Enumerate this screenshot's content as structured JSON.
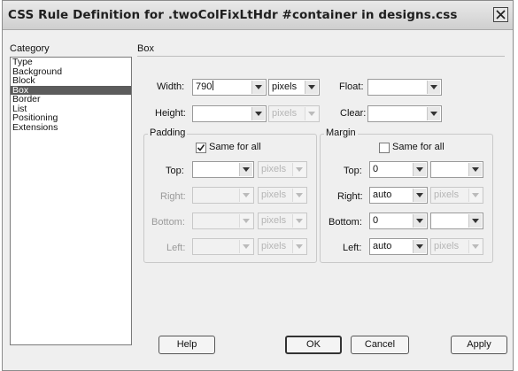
{
  "window": {
    "title": "CSS Rule Definition for .twoColFixLtHdr #container in designs.css"
  },
  "category": {
    "heading": "Category",
    "items": [
      "Type",
      "Background",
      "Block",
      "Box",
      "Border",
      "List",
      "Positioning",
      "Extensions"
    ],
    "selected": "Box"
  },
  "section": {
    "title": "Box"
  },
  "box": {
    "width": {
      "label": "Width:",
      "value": "790",
      "unit": "pixels"
    },
    "height": {
      "label": "Height:",
      "value": "",
      "unit": "pixels"
    },
    "float": {
      "label": "Float:",
      "value": ""
    },
    "clear": {
      "label": "Clear:",
      "value": ""
    }
  },
  "padding": {
    "title": "Padding",
    "same_for_all_label": "Same for all",
    "same_for_all_checked": true,
    "top": {
      "label": "Top:",
      "value": "",
      "unit": "pixels"
    },
    "right": {
      "label": "Right:",
      "value": "",
      "unit": "pixels"
    },
    "bottom": {
      "label": "Bottom:",
      "value": "",
      "unit": "pixels"
    },
    "left": {
      "label": "Left:",
      "value": "",
      "unit": "pixels"
    }
  },
  "margin": {
    "title": "Margin",
    "same_for_all_label": "Same for all",
    "same_for_all_checked": false,
    "top": {
      "label": "Top:",
      "value": "0",
      "unit": ""
    },
    "right": {
      "label": "Right:",
      "value": "auto",
      "unit": "pixels"
    },
    "bottom": {
      "label": "Bottom:",
      "value": "0",
      "unit": ""
    },
    "left": {
      "label": "Left:",
      "value": "auto",
      "unit": "pixels"
    }
  },
  "buttons": {
    "help": "Help",
    "ok": "OK",
    "cancel": "Cancel",
    "apply": "Apply"
  },
  "icons": {
    "close": "close-icon",
    "dropdown": "chevron-down-icon",
    "check": "check-icon"
  }
}
